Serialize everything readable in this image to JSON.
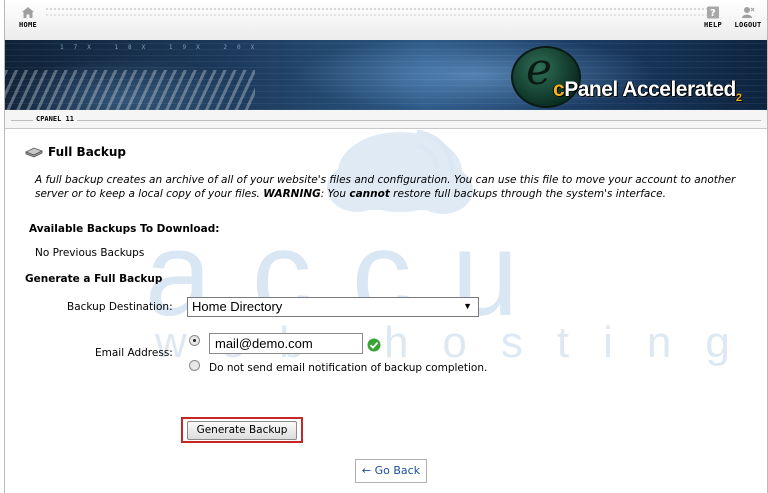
{
  "nav": {
    "home_label": "HOME",
    "help_label": "HELP",
    "logout_label": "LOGOUT"
  },
  "banner": {
    "brand_prefix": "c",
    "brand_main": "Panel Accelerated",
    "brand_version": "2",
    "port_labels": "17X  18X  19X  20X"
  },
  "breadcrumb": "CPANEL 11",
  "watermark": {
    "word": "accu",
    "sub": "web hosting"
  },
  "page": {
    "title": "Full Backup",
    "desc_part1": "A full backup creates an archive of all of your website's files and configuration. You can use this file to move your account to another server or to keep a local copy of your files. ",
    "desc_warning": "WARNING",
    "desc_part2": ": You ",
    "desc_cannot": "cannot",
    "desc_part3": " restore full backups through the system's interface.",
    "available_heading": "Available Backups To Download:",
    "no_backups": "No Previous Backups",
    "generate_heading": "Generate a Full Backup"
  },
  "form": {
    "destination_label": "Backup Destination:",
    "destination_value": "Home Directory",
    "email_label": "Email Address:",
    "email_value": "mail@demo.com",
    "no_email_label": "Do not send email notification of backup completion.",
    "generate_button": "Generate Backup",
    "go_back": "← Go Back"
  },
  "colors": {
    "highlight_border": "#c62828",
    "link": "#1a4fa3",
    "ok_green": "#3aa335",
    "watermark": "#c9dcef"
  }
}
